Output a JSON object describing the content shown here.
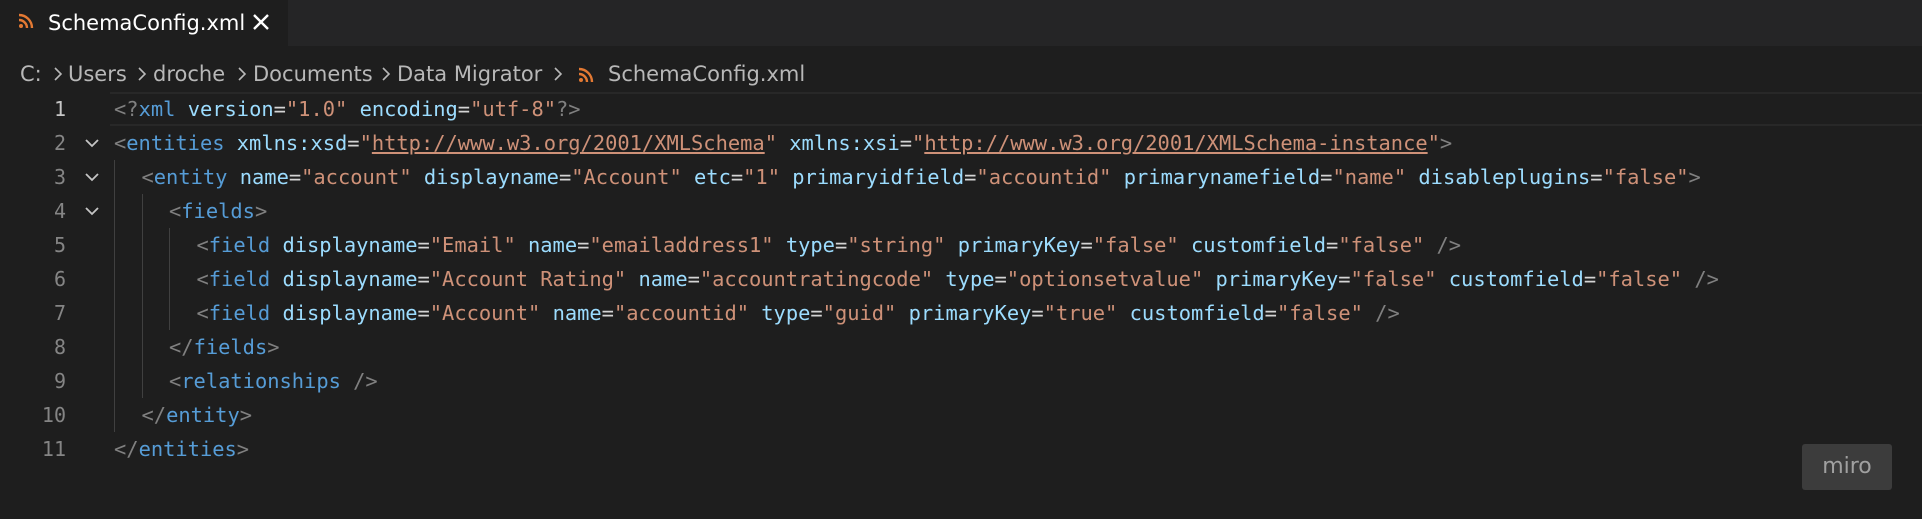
{
  "tab": {
    "label": "SchemaConfig.xml",
    "icon": "rss-icon",
    "icon_color": "#e37933",
    "close_icon": "close-icon"
  },
  "breadcrumb": {
    "items": [
      "C:",
      "Users",
      "droche",
      "Documents",
      "Data Migrator",
      "SchemaConfig.xml"
    ]
  },
  "editor": {
    "current_line": 1,
    "lines": [
      {
        "number": "1",
        "foldable": false
      },
      {
        "number": "2",
        "foldable": true
      },
      {
        "number": "3",
        "foldable": true
      },
      {
        "number": "4",
        "foldable": true
      },
      {
        "number": "5",
        "foldable": false
      },
      {
        "number": "6",
        "foldable": false
      },
      {
        "number": "7",
        "foldable": false
      },
      {
        "number": "8",
        "foldable": false
      },
      {
        "number": "9",
        "foldable": false
      },
      {
        "number": "10",
        "foldable": false
      },
      {
        "number": "11",
        "foldable": false
      }
    ],
    "code": [
      [
        [
          "punct",
          "<?"
        ],
        [
          "tag",
          "xml"
        ],
        [
          "plain",
          " "
        ],
        [
          "attr",
          "version"
        ],
        [
          "eq",
          "="
        ],
        [
          "str",
          "\"1.0\""
        ],
        [
          "plain",
          " "
        ],
        [
          "attr",
          "encoding"
        ],
        [
          "eq",
          "="
        ],
        [
          "str",
          "\"utf-8\""
        ],
        [
          "punct",
          "?>"
        ]
      ],
      [
        [
          "punct",
          "<"
        ],
        [
          "tag",
          "entities"
        ],
        [
          "plain",
          " "
        ],
        [
          "attr",
          "xmlns:xsd"
        ],
        [
          "eq",
          "="
        ],
        [
          "str",
          "\""
        ],
        [
          "url",
          "http://www.w3.org/2001/XMLSchema"
        ],
        [
          "str",
          "\""
        ],
        [
          "plain",
          " "
        ],
        [
          "attr",
          "xmlns:xsi"
        ],
        [
          "eq",
          "="
        ],
        [
          "str",
          "\""
        ],
        [
          "url",
          "http://www.w3.org/2001/XMLSchema-instance"
        ],
        [
          "str",
          "\""
        ],
        [
          "punct",
          ">"
        ]
      ],
      [
        [
          "punct",
          "<"
        ],
        [
          "tag",
          "entity"
        ],
        [
          "plain",
          " "
        ],
        [
          "attr",
          "name"
        ],
        [
          "eq",
          "="
        ],
        [
          "str",
          "\"account\""
        ],
        [
          "plain",
          " "
        ],
        [
          "attr",
          "displayname"
        ],
        [
          "eq",
          "="
        ],
        [
          "str",
          "\"Account\""
        ],
        [
          "plain",
          " "
        ],
        [
          "attr",
          "etc"
        ],
        [
          "eq",
          "="
        ],
        [
          "str",
          "\"1\""
        ],
        [
          "plain",
          " "
        ],
        [
          "attr",
          "primaryidfield"
        ],
        [
          "eq",
          "="
        ],
        [
          "str",
          "\"accountid\""
        ],
        [
          "plain",
          " "
        ],
        [
          "attr",
          "primarynamefield"
        ],
        [
          "eq",
          "="
        ],
        [
          "str",
          "\"name\""
        ],
        [
          "plain",
          " "
        ],
        [
          "attr",
          "disableplugins"
        ],
        [
          "eq",
          "="
        ],
        [
          "str",
          "\"false\""
        ],
        [
          "punct",
          ">"
        ]
      ],
      [
        [
          "punct",
          "<"
        ],
        [
          "tag",
          "fields"
        ],
        [
          "punct",
          ">"
        ]
      ],
      [
        [
          "punct",
          "<"
        ],
        [
          "tag",
          "field"
        ],
        [
          "plain",
          " "
        ],
        [
          "attr",
          "displayname"
        ],
        [
          "eq",
          "="
        ],
        [
          "str",
          "\"Email\""
        ],
        [
          "plain",
          " "
        ],
        [
          "attr",
          "name"
        ],
        [
          "eq",
          "="
        ],
        [
          "str",
          "\"emailaddress1\""
        ],
        [
          "plain",
          " "
        ],
        [
          "attr",
          "type"
        ],
        [
          "eq",
          "="
        ],
        [
          "str",
          "\"string\""
        ],
        [
          "plain",
          " "
        ],
        [
          "attr",
          "primaryKey"
        ],
        [
          "eq",
          "="
        ],
        [
          "str",
          "\"false\""
        ],
        [
          "plain",
          " "
        ],
        [
          "attr",
          "customfield"
        ],
        [
          "eq",
          "="
        ],
        [
          "str",
          "\"false\""
        ],
        [
          "plain",
          " "
        ],
        [
          "punct",
          "/>"
        ]
      ],
      [
        [
          "punct",
          "<"
        ],
        [
          "tag",
          "field"
        ],
        [
          "plain",
          " "
        ],
        [
          "attr",
          "displayname"
        ],
        [
          "eq",
          "="
        ],
        [
          "str",
          "\"Account Rating\""
        ],
        [
          "plain",
          " "
        ],
        [
          "attr",
          "name"
        ],
        [
          "eq",
          "="
        ],
        [
          "str",
          "\"accountratingcode\""
        ],
        [
          "plain",
          " "
        ],
        [
          "attr",
          "type"
        ],
        [
          "eq",
          "="
        ],
        [
          "str",
          "\"optionsetvalue\""
        ],
        [
          "plain",
          " "
        ],
        [
          "attr",
          "primaryKey"
        ],
        [
          "eq",
          "="
        ],
        [
          "str",
          "\"false\""
        ],
        [
          "plain",
          " "
        ],
        [
          "attr",
          "customfield"
        ],
        [
          "eq",
          "="
        ],
        [
          "str",
          "\"false\""
        ],
        [
          "plain",
          " "
        ],
        [
          "punct",
          "/>"
        ]
      ],
      [
        [
          "punct",
          "<"
        ],
        [
          "tag",
          "field"
        ],
        [
          "plain",
          " "
        ],
        [
          "attr",
          "displayname"
        ],
        [
          "eq",
          "="
        ],
        [
          "str",
          "\"Account\""
        ],
        [
          "plain",
          " "
        ],
        [
          "attr",
          "name"
        ],
        [
          "eq",
          "="
        ],
        [
          "str",
          "\"accountid\""
        ],
        [
          "plain",
          " "
        ],
        [
          "attr",
          "type"
        ],
        [
          "eq",
          "="
        ],
        [
          "str",
          "\"guid\""
        ],
        [
          "plain",
          " "
        ],
        [
          "attr",
          "primaryKey"
        ],
        [
          "eq",
          "="
        ],
        [
          "str",
          "\"true\""
        ],
        [
          "plain",
          " "
        ],
        [
          "attr",
          "customfield"
        ],
        [
          "eq",
          "="
        ],
        [
          "str",
          "\"false\""
        ],
        [
          "plain",
          " "
        ],
        [
          "punct",
          "/>"
        ]
      ],
      [
        [
          "punct",
          "</"
        ],
        [
          "tag",
          "fields"
        ],
        [
          "punct",
          ">"
        ]
      ],
      [
        [
          "punct",
          "<"
        ],
        [
          "tag",
          "relationships"
        ],
        [
          "plain",
          " "
        ],
        [
          "punct",
          "/>"
        ]
      ],
      [
        [
          "punct",
          "</"
        ],
        [
          "tag",
          "entity"
        ],
        [
          "punct",
          ">"
        ]
      ],
      [
        [
          "punct",
          "</"
        ],
        [
          "tag",
          "entities"
        ],
        [
          "punct",
          ">"
        ]
      ]
    ]
  },
  "watermark": {
    "label": "miro"
  },
  "colors": {
    "background": "#1e1e1e",
    "tag": "#569cd6",
    "attribute": "#9cdcfe",
    "string": "#ce9178",
    "punctuation": "#808080"
  }
}
